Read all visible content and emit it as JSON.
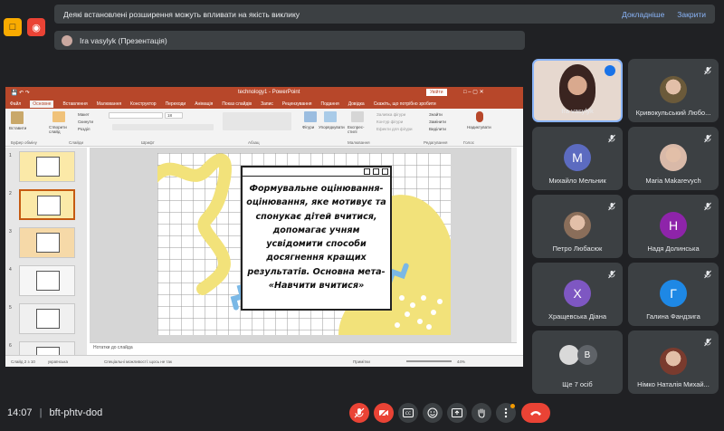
{
  "banner": {
    "warning_text": "Деякі встановлені розширення можуть впливати на якість виклику",
    "details_link": "Докладніше",
    "close_link": "Закрити"
  },
  "presenter": {
    "label": "Ira vasylyk (Презентація)"
  },
  "powerpoint": {
    "window_title": "technology1 - PowerPoint",
    "sign_in": "Увійти",
    "menu": [
      "Файл",
      "Основне",
      "Вставлення",
      "Малювання",
      "Конструктор",
      "Переходи",
      "Анімація",
      "Показ слайдів",
      "Запис",
      "Рецензування",
      "Подання",
      "Довідка",
      "Скажіть, що потрібно зробити"
    ],
    "ribbon_groups": [
      "Буфер обміну",
      "Слайди",
      "Шрифт",
      "Абзац",
      "Малювання",
      "Редагування",
      "Голос"
    ],
    "ribbon_items": {
      "paste": "Вставити",
      "new_slide": "Створити слайд",
      "layout": "Макет",
      "reset": "Скинути",
      "section": "Розділ",
      "shapes": "Фігури",
      "arrange": "Упорядкувати",
      "quick_styles": "Експрес-стилі",
      "shape_fill": "Заливка фігури",
      "shape_outline": "Контур фігури",
      "shape_effects": "Ефекти для фігури",
      "find": "Знайти",
      "replace": "Замінити",
      "select": "Виділити",
      "dictate": "Надиктувати"
    },
    "font_size": "18",
    "thumb_numbers": [
      "1",
      "2",
      "3",
      "4",
      "5",
      "6"
    ],
    "slide_text": "Формувальне оцінювання-оцінювання, яке мотивує та спонукає дітей вчитися, допомагає учням усвідомити способи досягнення кращих результатів. Основна мета- «Навчити вчитися»",
    "notes_placeholder": "Нотатки до слайда",
    "status": {
      "slide": "Слайд 2 з 10",
      "language": "українська",
      "accessibility": "Спеціальні можливості: щось не так",
      "notes": "Примітки",
      "zoom": "44%"
    }
  },
  "participants": [
    {
      "name": "Ira vasylyk",
      "initial": "",
      "color": "#e0cfc4",
      "mic": "active"
    },
    {
      "name": "Кривокульський Любо...",
      "initial": "",
      "color": "#6b5a3a",
      "mic": "muted"
    },
    {
      "name": "Михайло Мельник",
      "initial": "М",
      "color": "#5c6bc0",
      "mic": "muted"
    },
    {
      "name": "Maria Makarevych",
      "initial": "",
      "color": "#d9b9a8",
      "mic": "muted"
    },
    {
      "name": "Петро Любасюк",
      "initial": "",
      "color": "#8a6e5a",
      "mic": "muted"
    },
    {
      "name": "Надя Долинська",
      "initial": "Н",
      "color": "#8e24aa",
      "mic": "muted"
    },
    {
      "name": "Хращевська Діана",
      "initial": "Х",
      "color": "#7e57c2",
      "mic": "muted"
    },
    {
      "name": "Галина Фандзига",
      "initial": "Г",
      "color": "#1e88e5",
      "mic": "muted"
    },
    {
      "name": "Ще 7 осіб",
      "initial": "В",
      "color": "#5f6368",
      "mic": "none"
    },
    {
      "name": "Німко Наталія Михай...",
      "initial": "",
      "color": "#7a3b2e",
      "mic": "muted"
    }
  ],
  "footer": {
    "time": "14:07",
    "meeting_code": "bft-phtv-dod"
  },
  "colors": {
    "background": "#202124",
    "tile": "#3c4043",
    "danger": "#ea4335",
    "link": "#8ab4f8",
    "ppt_accent": "#b7472a",
    "slide_yellow": "#f2e27a",
    "slide_blue": "#7ab8e6"
  }
}
